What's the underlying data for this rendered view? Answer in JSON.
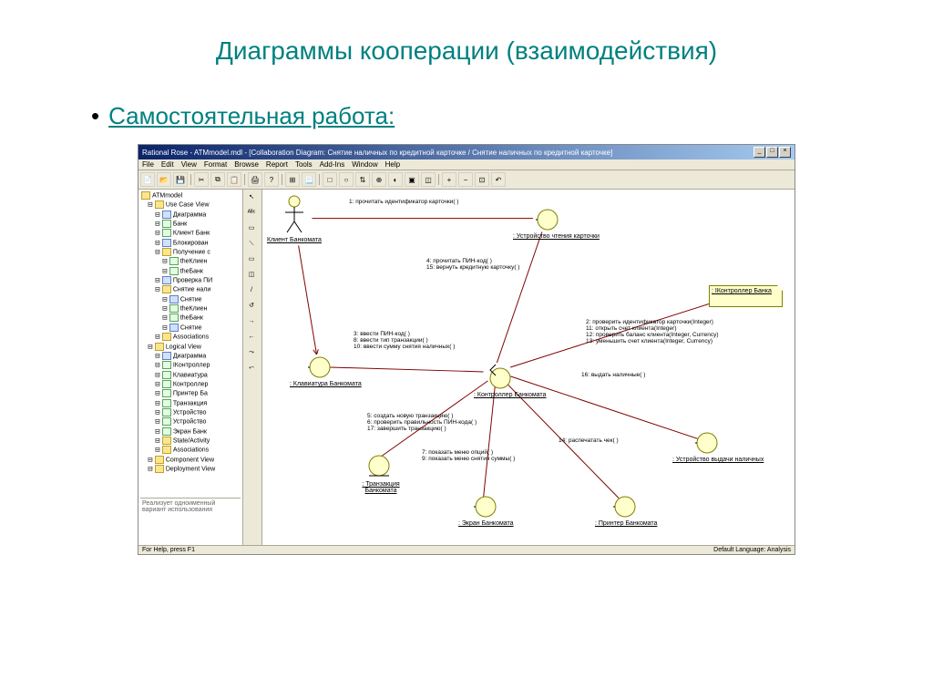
{
  "slide": {
    "title": "Диаграммы кооперации (взаимодействия)",
    "bullet": "Самостоятельная работа:"
  },
  "window": {
    "app": "Rational Rose",
    "title": "Rational Rose - ATMmodel.mdl - [Collaboration Diagram: Снятие наличных по кредитной карточке / Снятие наличных по кредитной карточке]"
  },
  "menubar": [
    "File",
    "Edit",
    "View",
    "Format",
    "Browse",
    "Report",
    "Tools",
    "Add-Ins",
    "Window",
    "Help"
  ],
  "tree": {
    "root": "ATMmodel",
    "items": [
      {
        "l": 1,
        "t": "folder",
        "text": "Use Case View"
      },
      {
        "l": 2,
        "t": "diag",
        "text": "Диаграмма"
      },
      {
        "l": 2,
        "t": "class",
        "text": "Банк"
      },
      {
        "l": 2,
        "t": "class",
        "text": "Клиент Банк"
      },
      {
        "l": 2,
        "t": "diag",
        "text": "Блокирован"
      },
      {
        "l": 2,
        "t": "folder",
        "text": "Получение с"
      },
      {
        "l": 3,
        "t": "class",
        "text": "theКлиен"
      },
      {
        "l": 3,
        "t": "class",
        "text": "theБанк"
      },
      {
        "l": 2,
        "t": "diag",
        "text": "Проверка ПИ"
      },
      {
        "l": 2,
        "t": "folder",
        "text": "Снятие нали"
      },
      {
        "l": 3,
        "t": "diag",
        "text": "Снятие"
      },
      {
        "l": 3,
        "t": "class",
        "text": "theКлиен"
      },
      {
        "l": 3,
        "t": "class",
        "text": "theБанк"
      },
      {
        "l": 3,
        "t": "diag",
        "text": "Снятие"
      },
      {
        "l": 2,
        "t": "folder",
        "text": "Associations"
      },
      {
        "l": 1,
        "t": "folder",
        "text": "Logical View"
      },
      {
        "l": 2,
        "t": "diag",
        "text": "Диаграмма"
      },
      {
        "l": 2,
        "t": "class",
        "text": "IКонтроллер"
      },
      {
        "l": 2,
        "t": "class",
        "text": "Клавиатура"
      },
      {
        "l": 2,
        "t": "class",
        "text": "Контроллер"
      },
      {
        "l": 2,
        "t": "class",
        "text": "Принтер Ба"
      },
      {
        "l": 2,
        "t": "class",
        "text": "Транзакция"
      },
      {
        "l": 2,
        "t": "class",
        "text": "Устройство"
      },
      {
        "l": 2,
        "t": "class",
        "text": "Устройство"
      },
      {
        "l": 2,
        "t": "class",
        "text": "Экран Банк"
      },
      {
        "l": 2,
        "t": "folder",
        "text": "State/Activity"
      },
      {
        "l": 2,
        "t": "folder",
        "text": "Associations"
      },
      {
        "l": 1,
        "t": "folder",
        "text": "Component View"
      },
      {
        "l": 1,
        "t": "folder",
        "text": "Deployment View"
      }
    ]
  },
  "doc": "Реализует одноименный вариант использования",
  "objects": {
    "actor": "Клиент Банкомата",
    "cardReader": ": Устройство чтения карточки",
    "keyboard": ": Клавиатура Банкомата",
    "controller": ": Контроллер Банкомата",
    "bankInterface": ": IКонтроллер Банка",
    "cashDispenser": ": Устройство выдачи наличных",
    "transaction": ": Транзакция Банкомата",
    "screen": ": Экран Банкомата",
    "printer": ": Принтер Банкомата"
  },
  "messages": {
    "m1": "1: прочитать идентификатор карточки( )",
    "m4_15": "4: прочитать ПИН-код( )\n15: вернуть кредитную карточку( )",
    "m3_8_10": "3: ввести ПИН-код( )\n8: ввести тип транзакции( )\n10: ввести сумму снятия наличных( )",
    "m2_11_12_13": "2: проверить идентификатор карточки(Integer)\n11: открыть счет клиента(Integer)\n12: проверить баланс клиента(Integer, Currency)\n13: уменьшить счет клиента(Integer, Currency)",
    "m16": "16: выдать наличные( )",
    "m5_6_17": "5: создать новую транзакцию( )\n6: проверить правильность ПИН-кода( )\n17: завершить транзакцию( )",
    "m7_9": "7: показать меню опций( )\n9: показать меню снятия суммы( )",
    "m14": "14: распечатать чек( )"
  },
  "status": {
    "left": "For Help, press F1",
    "right": "Default Language: Analysis"
  }
}
